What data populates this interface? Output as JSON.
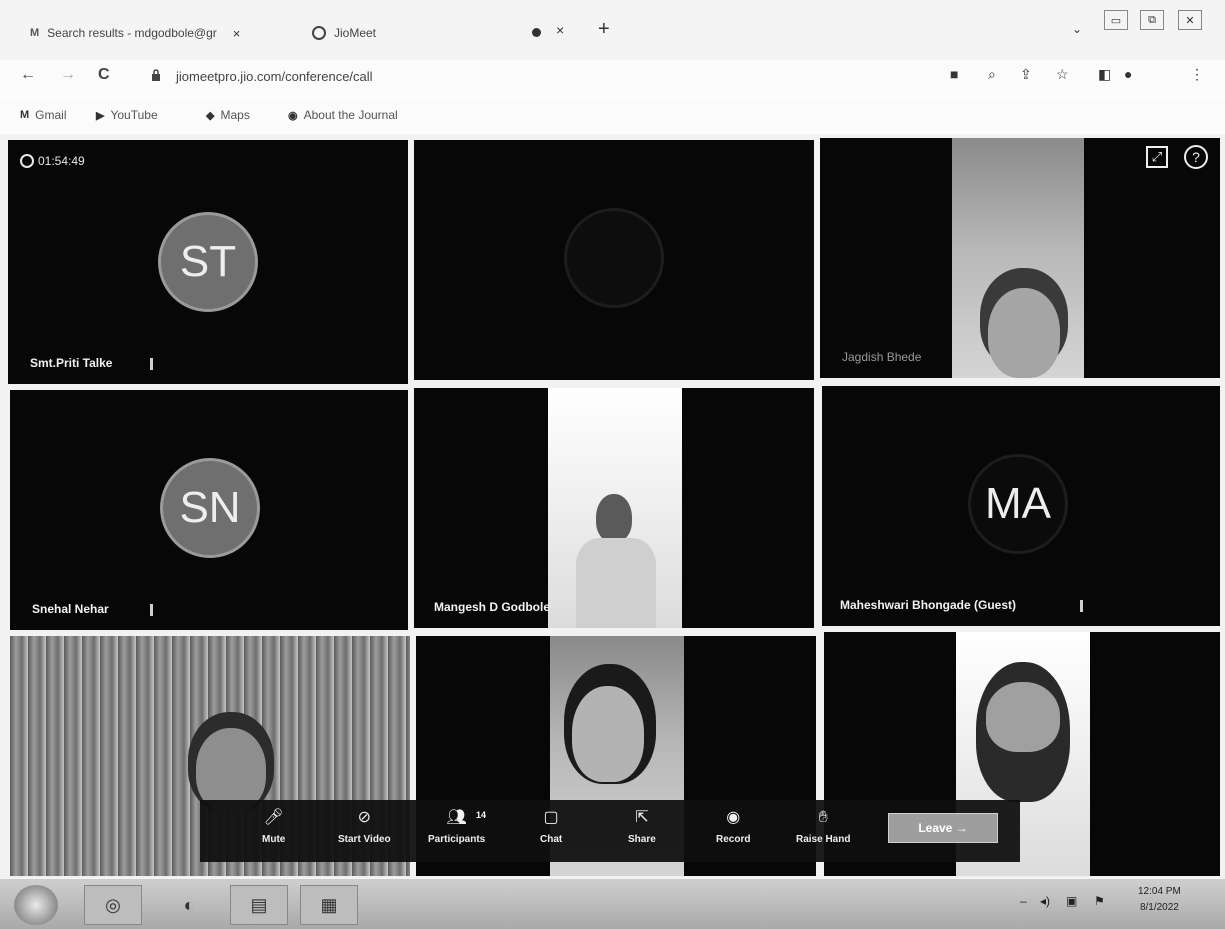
{
  "browser": {
    "tabs": [
      {
        "icon": "gmail-icon",
        "label": "Search results - mdgodbole@gr",
        "close": "×"
      },
      {
        "icon": "jiomeet-icon",
        "label": "JioMeet",
        "close": "×"
      }
    ],
    "new_tab": "+",
    "tab_search": "⌄",
    "window_controls": [
      "▭",
      "⧉",
      "✕"
    ],
    "nav": {
      "back": "←",
      "forward": "→",
      "reload": "C"
    },
    "url": "jiomeetpro.jio.com/conference/call",
    "toolbar_icons": [
      "camera-icon",
      "zoom-icon",
      "share-icon",
      "star-icon",
      "sidepanel-icon",
      "profile-icon",
      "menu-icon"
    ],
    "bookmarks": [
      {
        "icon": "M",
        "label": "Gmail"
      },
      {
        "icon": "▶",
        "label": "YouTube"
      },
      {
        "icon": "◆",
        "label": "Maps"
      },
      {
        "icon": "◉",
        "label": "About the Journal"
      }
    ]
  },
  "meeting": {
    "timer": "01:54:49",
    "participants": [
      {
        "name": "Smt.Priti Talke",
        "initials": "ST"
      },
      {
        "name": "",
        "initials": ""
      },
      {
        "name": "Jagdish Bhede",
        "initials": ""
      },
      {
        "name": "Snehal Nehar",
        "initials": "SN"
      },
      {
        "name": "Mangesh D Godbole",
        "initials": ""
      },
      {
        "name": "Maheshwari Bhongade (Guest)",
        "initials": "MA"
      },
      {
        "name": "",
        "initials": ""
      },
      {
        "name": "",
        "initials": ""
      },
      {
        "name": "",
        "initials": ""
      }
    ],
    "toolbar": {
      "mute": "Mute",
      "start_video": "Start Video",
      "participants": "Participants",
      "participant_count": "14",
      "chat": "Chat",
      "share": "Share",
      "record": "Record",
      "raise_hand": "Raise Hand",
      "leave": "Leave →"
    }
  },
  "taskbar": {
    "clock_time": "12:04 PM",
    "clock_date": "8/1/2022"
  }
}
